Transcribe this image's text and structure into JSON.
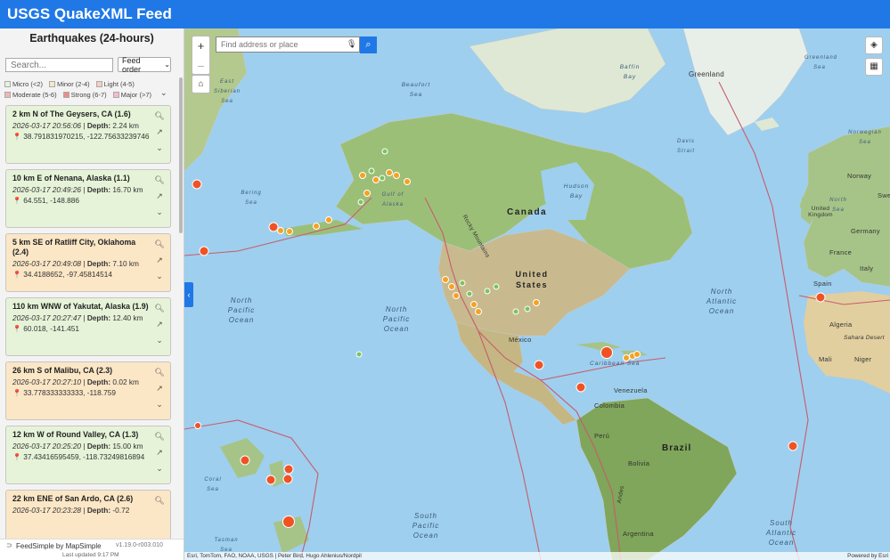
{
  "app": {
    "title": "USGS QuakeXML Feed"
  },
  "sidebar": {
    "title": "Earthquakes (24-hours)",
    "search_placeholder": "Search...",
    "order_label": "Feed order",
    "legend": [
      {
        "label": "Micro (<2)",
        "color": "#e6f3d8"
      },
      {
        "label": "Minor (2-4)",
        "color": "#fbe6c6"
      },
      {
        "label": "Light (4-5)",
        "color": "#f8cfbe"
      },
      {
        "label": "Moderate (5-6)",
        "color": "#f4b4b4"
      },
      {
        "label": "Strong (6-7)",
        "color": "#ee8b8b"
      },
      {
        "label": "Major (>7)",
        "color": "#f6b9cf"
      }
    ],
    "quakes": [
      {
        "title": "2 km N of The Geysers, CA (1.6)",
        "time": "2026-03-17 20:56:06",
        "depth_label": "Depth:",
        "depth": "2.24 km",
        "coords": "38.791831970215, -122.75633239746",
        "level": "green"
      },
      {
        "title": "10 km E of Nenana, Alaska (1.1)",
        "time": "2026-03-17 20:49:26",
        "depth_label": "Depth:",
        "depth": "16.70 km",
        "coords": "64.551, -148.886",
        "level": "green"
      },
      {
        "title": "5 km SE of Ratliff City, Oklahoma (2.4)",
        "time": "2026-03-17 20:49:08",
        "depth_label": "Depth:",
        "depth": "7.10 km",
        "coords": "34.4188652, -97.45814514",
        "level": "orange"
      },
      {
        "title": "110 km WNW of Yakutat, Alaska (1.9)",
        "time": "2026-03-17 20:27:47",
        "depth_label": "Depth:",
        "depth": "12.40 km",
        "coords": "60.018, -141.451",
        "level": "green"
      },
      {
        "title": "26 km S of Malibu, CA (2.3)",
        "time": "2026-03-17 20:27:10",
        "depth_label": "Depth:",
        "depth": "0.02 km",
        "coords": "33.778333333333, -118.759",
        "level": "orange"
      },
      {
        "title": "12 km W of Round Valley, CA (1.3)",
        "time": "2026-03-17 20:25:20",
        "depth_label": "Depth:",
        "depth": "15.00 km",
        "coords": "37.43416595459, -118.73249816894",
        "level": "green"
      },
      {
        "title": "22 km ENE of San Ardo, CA (2.6)",
        "time": "2026-03-17 20:23:28",
        "depth_label": "Depth:",
        "depth": "-0.72",
        "coords": "",
        "level": "orange"
      }
    ],
    "footer": {
      "brand": "FeedSimple by MapSimple",
      "version": "v1.19.0-r003.010",
      "updated": "Last updated 9:17 PM"
    }
  },
  "map": {
    "search_placeholder": "Find address or place",
    "zoom_in": "+",
    "zoom_out": "–",
    "attribution": "Esri, TomTom, FAO, NOAA, USGS | Peter Bird, Hugo Ahlenius/Nordpil",
    "powered_by": "Powered by Esri",
    "labels": {
      "greenland": "Greenland",
      "canada": "Canada",
      "united_states": "United States",
      "mexico": "México",
      "venezuela": "Venezuela",
      "colombia": "Colombia",
      "peru": "Perú",
      "brazil": "Brazil",
      "bolivia": "Bolivia",
      "argentina": "Argentina",
      "norway": "Norway",
      "sweden": "Swe",
      "united_kingdom": "United Kingdom",
      "germany": "Germany",
      "france": "France",
      "spain": "Spain",
      "italy": "Italy",
      "algeria": "Algeria",
      "mali": "Mali",
      "niger": "Niger",
      "sahara": "Sahara Desert",
      "hudson_bay": "Hudson Bay",
      "baffin_bay": "Baffin Bay",
      "beaufort_sea": "Beaufort Sea",
      "caribbean": "Caribbean Sea",
      "east_siberian_sea": "East Siberian Sea",
      "bering_sea": "Bering Sea",
      "gulf_of_alaska": "Gulf of Alaska",
      "rocky_mountains": "Rocky Mountains",
      "davis_strait": "Davis Strait",
      "norwegian_sea": "Norwegian Sea",
      "greenland_sea": "Greenland Sea",
      "north_sea": "North Sea",
      "coral_sea": "Coral Sea",
      "tasman_sea": "Tasman Sea",
      "andes": "Andes",
      "north_pacific_1": "North Pacific Ocean",
      "north_pacific_2": "North Pacific Ocean",
      "north_atlantic": "North Atlantic Ocean",
      "south_pacific": "South Pacific Ocean",
      "south_atlantic": "South Atlantic Ocean"
    }
  }
}
